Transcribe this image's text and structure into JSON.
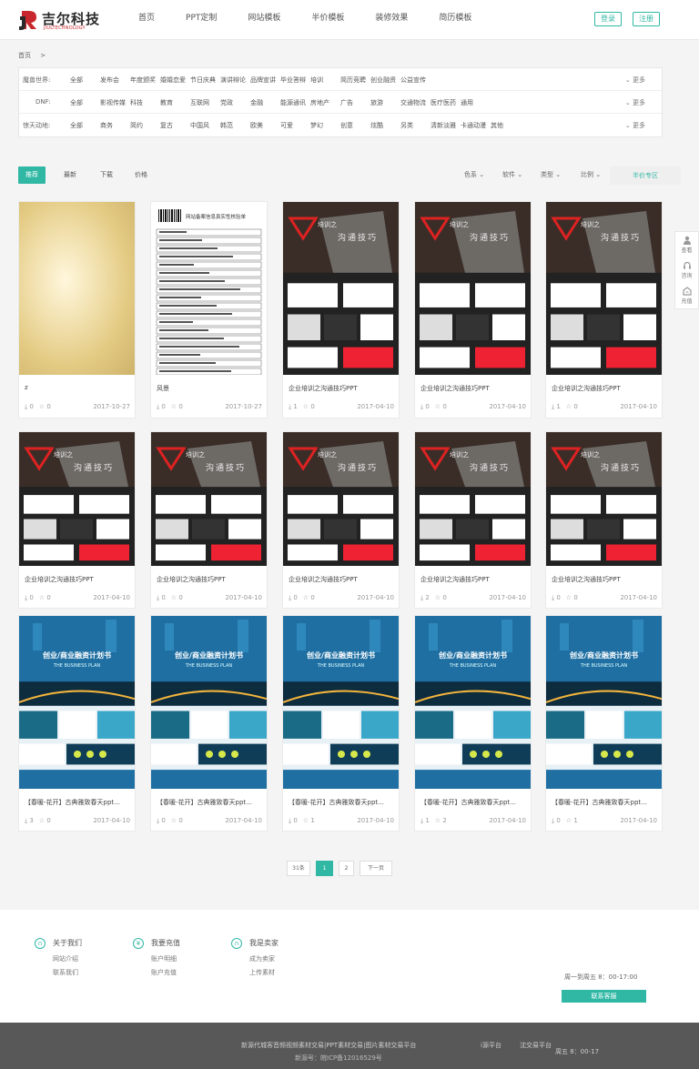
{
  "header": {
    "logo_cn": "吉尔科技",
    "logo_en": "JIULTECHNOLOGY",
    "nav": [
      "首页",
      "PPT定制",
      "网站模板",
      "半价模板",
      "装修效果",
      "简历模板"
    ],
    "login": "登录",
    "register": "注册"
  },
  "breadcrumb": {
    "home": "首页",
    "sep": ">"
  },
  "filters": [
    {
      "label": "魔兽世界:",
      "options": [
        "全部",
        "发布会",
        "年度颁奖",
        "婚婚恋爱",
        "节日庆典",
        "演讲辩论",
        "品牌宣讲",
        "毕业答辩",
        "培训",
        "简历竞聘",
        "创业融资",
        "公益宣传"
      ]
    },
    {
      "label": "DNF:",
      "options": [
        "全部",
        "影视传媒",
        "科技",
        "教育",
        "互联网",
        "党政",
        "金融",
        "能源通讯",
        "房地产",
        "广告",
        "旅游",
        "交通物流",
        "医疗医药",
        "通用"
      ]
    },
    {
      "label": "惊天动地:",
      "options": [
        "全部",
        "商务",
        "简约",
        "复古",
        "中国风",
        "韩范",
        "欧美",
        "可爱",
        "梦幻",
        "创意",
        "炫酷",
        "另类",
        "清新淡雅",
        "卡通动漫",
        "其他"
      ]
    }
  ],
  "filter_more": "更多",
  "sort": {
    "tabs": [
      "推荐",
      "最新",
      "下载",
      "价格"
    ],
    "dropdowns": [
      "色系",
      "软件",
      "类型",
      "比例"
    ],
    "half_zone": "半价专区"
  },
  "side": [
    "查看",
    "咨询",
    "充值"
  ],
  "cards": [
    {
      "img": "marble",
      "title": "z",
      "dl": "0",
      "fav": "0",
      "date": "2017-10-27"
    },
    {
      "img": "doc",
      "title": "风景",
      "dl": "0",
      "fav": "0",
      "date": "2017-10-27"
    },
    {
      "img": "dark",
      "title": "企业培训之沟通技巧PPT",
      "dl": "1",
      "fav": "0",
      "date": "2017-04-10"
    },
    {
      "img": "dark",
      "title": "企业培训之沟通技巧PPT",
      "dl": "0",
      "fav": "0",
      "date": "2017-04-10"
    },
    {
      "img": "dark",
      "title": "企业培训之沟通技巧PPT",
      "dl": "1",
      "fav": "0",
      "date": "2017-04-10"
    },
    {
      "img": "dark",
      "title": "企业培训之沟通技巧PPT",
      "dl": "0",
      "fav": "0",
      "date": "2017-04-10"
    },
    {
      "img": "dark",
      "title": "企业培训之沟通技巧PPT",
      "dl": "0",
      "fav": "0",
      "date": "2017-04-10"
    },
    {
      "img": "dark",
      "title": "企业培训之沟通技巧PPT",
      "dl": "0",
      "fav": "0",
      "date": "2017-04-10"
    },
    {
      "img": "dark",
      "title": "企业培训之沟通技巧PPT",
      "dl": "2",
      "fav": "0",
      "date": "2017-04-10"
    },
    {
      "img": "dark",
      "title": "企业培训之沟通技巧PPT",
      "dl": "0",
      "fav": "0",
      "date": "2017-04-10"
    },
    {
      "img": "biz",
      "title": "【春暖-花开】古典雅致春天ppt...",
      "dl": "3",
      "fav": "0",
      "date": "2017-04-10"
    },
    {
      "img": "biz",
      "title": "【春暖-花开】古典雅致春天ppt...",
      "dl": "0",
      "fav": "0",
      "date": "2017-04-10"
    },
    {
      "img": "biz",
      "title": "【春暖-花开】古典雅致春天ppt...",
      "dl": "0",
      "fav": "1",
      "date": "2017-04-10"
    },
    {
      "img": "biz",
      "title": "【春暖-花开】古典雅致春天ppt...",
      "dl": "1",
      "fav": "2",
      "date": "2017-04-10"
    },
    {
      "img": "biz",
      "title": "【春暖-花开】古典雅致春天ppt...",
      "dl": "0",
      "fav": "1",
      "date": "2017-04-10"
    }
  ],
  "thumb_text": {
    "dark_line1": "培训之",
    "dark_line2": "沟通技巧",
    "biz_title": "创业/商业融资计划书",
    "biz_sub": "THE BUSINESS PLAN",
    "doc_header": "网站备案信息真实性核验单"
  },
  "pager": {
    "total": "31条",
    "pages": [
      "1",
      "2"
    ],
    "next": "下一页"
  },
  "footer": {
    "cols": [
      {
        "icon": "∩",
        "title": "关于我们",
        "links": [
          "网站介绍",
          "联系我们"
        ]
      },
      {
        "icon": "¥",
        "title": "我要充值",
        "links": [
          "账户明细",
          "账户充值"
        ]
      },
      {
        "icon": "∩",
        "title": "我是卖家",
        "links": [
          "成为卖家",
          "上传素材"
        ]
      }
    ],
    "hours": "周一到周五 8：00-17:00",
    "service_btn": "联系客服"
  },
  "bottom": {
    "line1": "新源代城客音频视频素材交易|PPT素材交易|图片素材交易平台",
    "line2": "新源号：皖ICP备12016529号",
    "r1": "i源平台",
    "r2": "沈交易平台",
    "r3": "周五 8：00-17"
  },
  "colors": {
    "accent": "#30b8a5",
    "brand_red": "#c8282d"
  }
}
